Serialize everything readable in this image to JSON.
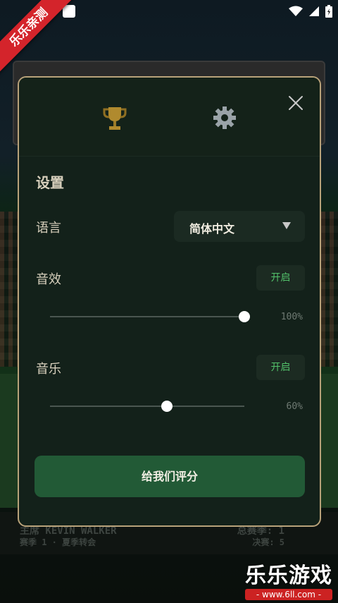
{
  "status_bar": {
    "icons": [
      "wifi-icon",
      "signal-icon",
      "battery-icon"
    ]
  },
  "ribbon": {
    "text": "乐乐亲测"
  },
  "background": {
    "player_line": "主席 KEVIN WALKER",
    "season_line": "赛季 1 · 夏季转会",
    "total_matches": "总赛季: 1",
    "finals": "决赛: 5"
  },
  "dialog": {
    "tabs": [
      "trophy-icon",
      "gear-icon"
    ],
    "section_title": "设置",
    "language": {
      "label": "语言",
      "value": "简体中文"
    },
    "sound_effects": {
      "label": "音效",
      "toggle": "开启",
      "volume": 100,
      "volume_text": "100%"
    },
    "music": {
      "label": "音乐",
      "toggle": "开启",
      "volume": 60,
      "volume_text": "60%"
    },
    "rate_button": "给我们评分"
  },
  "watermark": {
    "big": "乐乐游戏",
    "small": "- www.6ll.com -"
  },
  "colors": {
    "accent_green": "#52c06a",
    "button_green": "#225a36",
    "border_gold": "#b8a27a",
    "ribbon_red": "#d4242b"
  }
}
